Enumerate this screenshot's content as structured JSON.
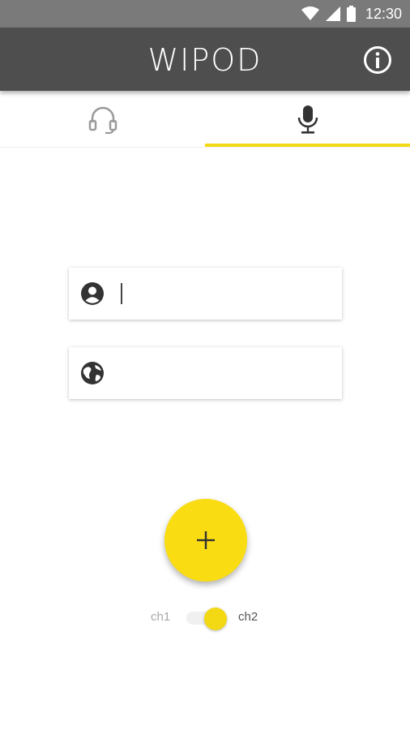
{
  "status_bar": {
    "time": "12:30",
    "icons": [
      "wifi-icon",
      "cell-signal-icon",
      "battery-icon"
    ]
  },
  "app_bar": {
    "title": "WIPOD",
    "info_icon": "info-icon"
  },
  "tabs": [
    {
      "name": "listen",
      "icon": "headphones-icon",
      "selected": false
    },
    {
      "name": "speak",
      "icon": "microphone-icon",
      "selected": true
    }
  ],
  "form": {
    "user_field": {
      "icon": "account-circle-icon",
      "value": "",
      "focused": true
    },
    "web_field": {
      "icon": "globe-icon",
      "value": ""
    }
  },
  "fab": {
    "icon": "plus-icon"
  },
  "channel_switch": {
    "left_label": "ch1",
    "right_label": "ch2",
    "selected": "ch2"
  },
  "colors": {
    "accent": "#f3d914",
    "app_bar": "#4e4e4e",
    "status_bar": "#7a7a7a"
  }
}
